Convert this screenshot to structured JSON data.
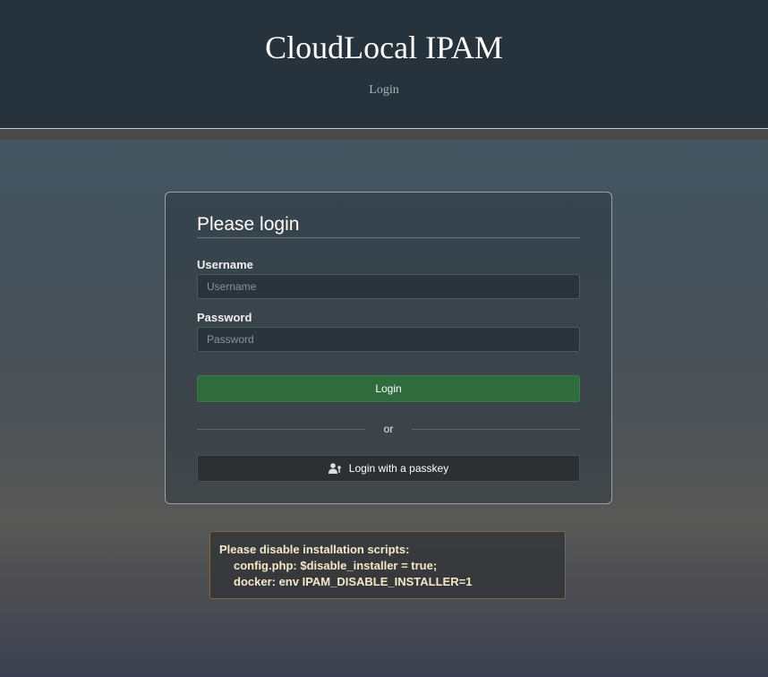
{
  "header": {
    "title": "CloudLocal IPAM",
    "subtitle": "Login"
  },
  "login": {
    "heading": "Please login",
    "username_label": "Username",
    "username_placeholder": "Username",
    "username_value": "",
    "password_label": "Password",
    "password_placeholder": "Password",
    "password_value": "",
    "login_button": "Login",
    "or_text": "or",
    "passkey_button": "Login with a passkey",
    "passkey_icon": "user-key-icon"
  },
  "warning": {
    "title": "Please disable installation scripts:",
    "lines": [
      "config.php: $disable_installer = true;",
      "docker: env IPAM_DISABLE_INSTALLER=1"
    ]
  },
  "colors": {
    "header_bg": "#27333c",
    "login_button": "#2f6b3d",
    "warning_border": "#7a6a48"
  }
}
